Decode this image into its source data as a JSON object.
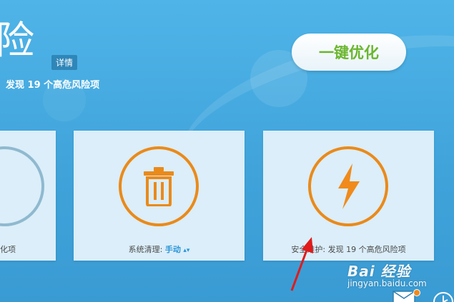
{
  "header": {
    "title": "险",
    "detail_label": "详情",
    "summary_text": "发现 19 个高危风险项"
  },
  "actions": {
    "one_click_optimize": "一键优化"
  },
  "cards": {
    "left": {
      "label_visible": "化项"
    },
    "middle": {
      "label_prefix": "系统清理: ",
      "mode_label": "手动",
      "mode_arrows": "▴▾"
    },
    "right": {
      "label": "安全维护: 发现 19 个高危风险项"
    }
  },
  "watermark": {
    "brand": "Bai 经验",
    "url": "jingyan.baidu.com"
  },
  "colors": {
    "background": "#45aae0",
    "card": "#dbeef9",
    "ring_orange": "#ea8a1a",
    "ring_grey": "#8fb9cf",
    "accent_green": "#6ab62e",
    "link_blue": "#2a95d8",
    "arrow_red": "#e01b1b"
  },
  "icons": {
    "left_card": "gauge-ring-icon",
    "middle_card": "trash-icon",
    "right_card": "lightning-icon",
    "bottom_bar": [
      "mail-icon",
      "clock-icon"
    ]
  }
}
